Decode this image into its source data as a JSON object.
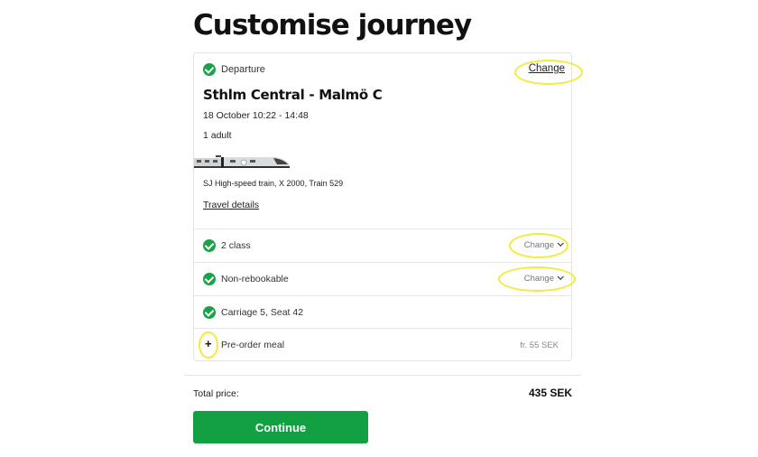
{
  "page": {
    "title": "Customise journey"
  },
  "departure": {
    "label": "Departure",
    "change_label": "Change",
    "route": "Sthlm Central - Malmö C",
    "datetime": "18 October 10:22 - 14:48",
    "passengers": "1 adult",
    "train_description": "SJ High-speed train, X 2000, Train 529",
    "travel_details_label": "Travel details"
  },
  "options": {
    "class": {
      "label": "2 class",
      "change_label": "Change"
    },
    "rebooking": {
      "label": "Non-rebookable",
      "change_label": "Change"
    },
    "seat": {
      "label": "Carriage 5, Seat 42"
    },
    "meal": {
      "add_symbol": "+",
      "label": "Pre-order meal",
      "price": "fr. 55 SEK"
    }
  },
  "total": {
    "label": "Total price:",
    "value": "435 SEK"
  },
  "actions": {
    "continue_label": "Continue"
  },
  "colors": {
    "accent": "#13a043",
    "check": "#1aa34a",
    "highlight": "#f3ea3a"
  },
  "icons": {
    "check": "check-circle-icon",
    "chevron": "chevron-down-icon",
    "train": "train-image"
  }
}
